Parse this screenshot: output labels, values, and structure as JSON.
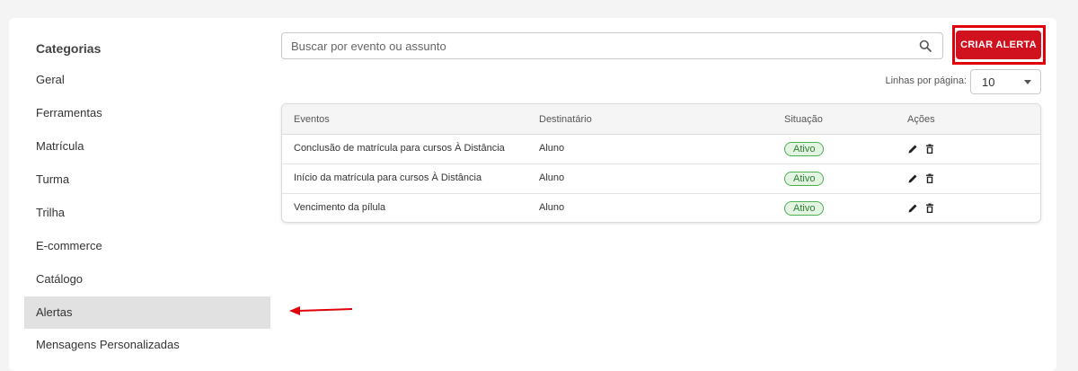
{
  "sidebar": {
    "title": "Categorias",
    "items": [
      {
        "label": "Geral",
        "active": false
      },
      {
        "label": "Ferramentas",
        "active": false
      },
      {
        "label": "Matrícula",
        "active": false
      },
      {
        "label": "Turma",
        "active": false
      },
      {
        "label": "Trilha",
        "active": false
      },
      {
        "label": "E-commerce",
        "active": false
      },
      {
        "label": "Catálogo",
        "active": false
      },
      {
        "label": "Alertas",
        "active": true
      },
      {
        "label": "Mensagens Personalizadas",
        "active": false
      }
    ]
  },
  "search": {
    "placeholder": "Buscar por evento ou assunto",
    "value": "",
    "icon": "search-icon"
  },
  "toolbar": {
    "create_label": "CRIAR ALERTA"
  },
  "pagination": {
    "rows_label": "Linhas por página:",
    "rows_value": "10"
  },
  "table": {
    "headers": {
      "event": "Eventos",
      "recipient": "Destinatário",
      "status": "Situação",
      "actions": "Ações"
    },
    "rows": [
      {
        "event": "Conclusão de matrícula para cursos À Distância",
        "recipient": "Aluno",
        "status": "Ativo"
      },
      {
        "event": "Início da matrícula para cursos À Distância",
        "recipient": "Aluno",
        "status": "Ativo"
      },
      {
        "event": "Vencimento da pílula",
        "recipient": "Aluno",
        "status": "Ativo"
      }
    ]
  },
  "colors": {
    "accent": "#d0121e",
    "highlight": "#e0000a",
    "status_active": "#4caf50",
    "sidebar_active_bg": "#e1e1e1"
  },
  "icons": [
    "search-icon",
    "pencil-icon",
    "trash-icon",
    "chevron-down-icon",
    "arrow-left-icon"
  ]
}
